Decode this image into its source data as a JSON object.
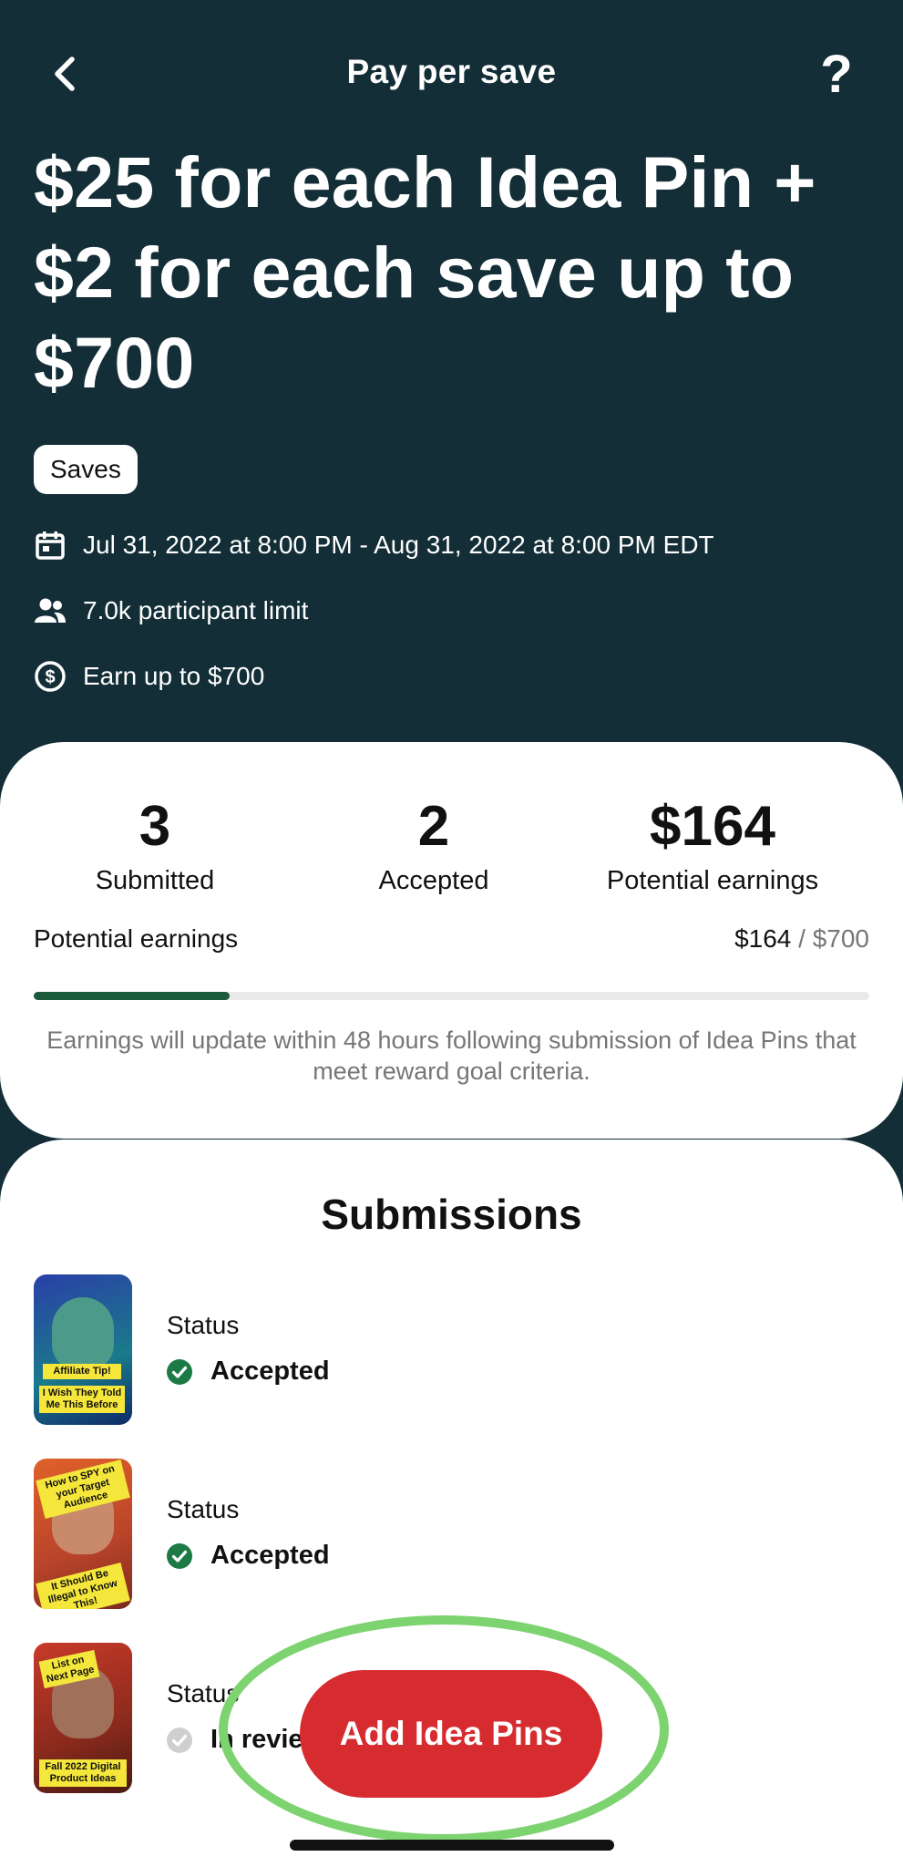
{
  "nav": {
    "title": "Pay per save",
    "back_icon": "chevron-left-icon",
    "help_label": "?"
  },
  "headline": "$25 for each Idea Pin + $2 for each save up to $700",
  "chip_label": "Saves",
  "meta": {
    "date_range": "Jul 31, 2022 at 8:00 PM - Aug 31, 2022 at 8:00 PM EDT",
    "participant_limit": "7.0k participant limit",
    "earn_up_to": "Earn up to $700"
  },
  "stats": [
    {
      "value": "3",
      "label": "Submitted"
    },
    {
      "value": "2",
      "label": "Accepted"
    },
    {
      "value": "$164",
      "label": "Potential earnings"
    }
  ],
  "earnings": {
    "label": "Potential earnings",
    "current": "$164",
    "separator": " / ",
    "max": "$700",
    "progress_fraction": 0.234
  },
  "note": "Earnings will update within 48 hours following submission of Idea Pins that meet reward goal criteria.",
  "submissions": {
    "title": "Submissions",
    "items": [
      {
        "status_label": "Status",
        "status": "Accepted",
        "tags": [
          "Affiliate Tip!",
          "I Wish They Told Me This Before"
        ]
      },
      {
        "status_label": "Status",
        "status": "Accepted",
        "tags": [
          "How to SPY on your Target Audience",
          "It Should Be Illegal to Know This!"
        ]
      },
      {
        "status_label": "Status",
        "status": "In review",
        "tags": [
          "List on Next Page",
          "Fall 2022 Digital Product Ideas"
        ]
      }
    ]
  },
  "cta": {
    "label": "Add Idea Pins"
  },
  "colors": {
    "header_bg": "#132e37",
    "accent_green": "#1c5a3c",
    "cta_red": "#d62b2f",
    "highlight_ring": "#7dd36f"
  }
}
